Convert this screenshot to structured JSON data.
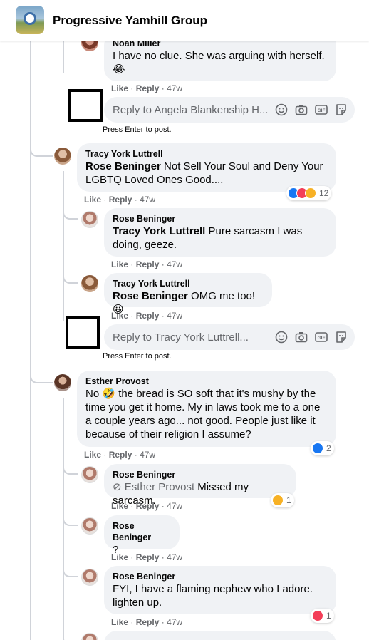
{
  "header": {
    "group_name": "Progressive Yamhill Group"
  },
  "noah": {
    "name": "Noah Miller",
    "text": "I have no clue. She was arguing with herself.",
    "emoji": "😂"
  },
  "actions": {
    "like": "Like",
    "reply": "Reply",
    "sep": "·",
    "time": "47w"
  },
  "reply_box_1": {
    "placeholder": "Reply to Angela Blankenship H..."
  },
  "reply_box_2": {
    "placeholder": "Reply to Tracy York Luttrell..."
  },
  "press_enter": "Press Enter to post.",
  "tracy_comment": {
    "name": "Tracy York Luttrell",
    "mention": "Rose Beninger",
    "text": " Not Sell Your Soul and Deny Your LGBTQ Loved Ones Good....",
    "reaction_count": "12"
  },
  "rose_reply_1": {
    "name": "Rose Beninger",
    "mention": "Tracy York Luttrell",
    "text": " Pure sarcasm I was doing, geeze."
  },
  "tracy_reply": {
    "name": "Tracy York Luttrell",
    "mention": "Rose Beninger",
    "text": " OMG me too! ",
    "emoji": "😀"
  },
  "esther_comment": {
    "name": "Esther Provost",
    "text_a": "No ",
    "emoji": "🤣",
    "text_b": " the bread is SO soft that it's mushy by the time you get it home. My in laws took me to a one a couple years ago... not good. People just like it because of their religion I assume?",
    "reaction_count": "2"
  },
  "rose_reply_2": {
    "name": "Rose Beninger",
    "mention": "Esther Provost",
    "text": " Missed my sarcasm.",
    "reaction_count": "1"
  },
  "rose_reply_3": {
    "name": "Rose Beninger",
    "text": "?"
  },
  "rose_reply_4": {
    "name": "Rose Beninger",
    "text": "FYI, I have a flaming nephew who I adore. lighten up.",
    "reaction_count": "1"
  },
  "icons": [
    "smiley-icon",
    "camera-icon",
    "gif-icon",
    "sticker-icon",
    "like-reaction-icon",
    "love-reaction-icon",
    "haha-reaction-icon"
  ],
  "colors": {
    "like": "#1877f2",
    "love": "#f33e58",
    "haha": "#f7b125",
    "bubble": "#f0f2f5",
    "muted": "#65676b"
  }
}
